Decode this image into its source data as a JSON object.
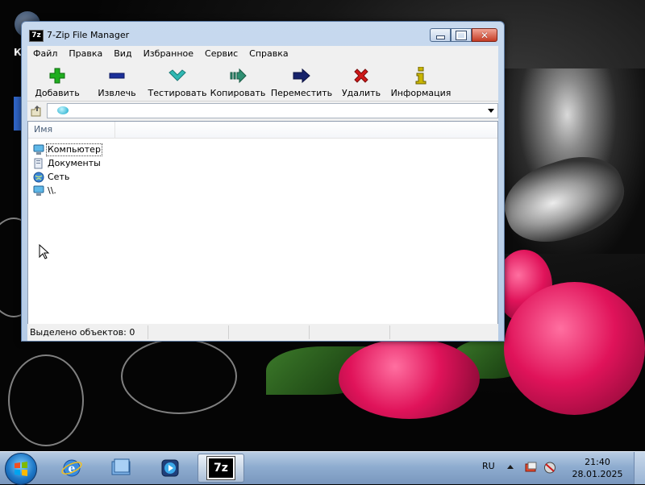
{
  "window": {
    "title": "7-Zip File Manager",
    "app_icon_text": "7z"
  },
  "menu": [
    "Файл",
    "Правка",
    "Вид",
    "Избранное",
    "Сервис",
    "Справка"
  ],
  "toolbar": {
    "add": "Добавить",
    "extract": "Извлечь",
    "test": "Тестировать",
    "copy": "Копировать",
    "move": "Переместить",
    "delete": "Удалить",
    "info": "Информация"
  },
  "address": {
    "value": ""
  },
  "list": {
    "column_name": "Имя",
    "items": [
      {
        "label": "Компьютер",
        "icon": "computer-icon"
      },
      {
        "label": "Документы",
        "icon": "documents-icon"
      },
      {
        "label": "Сеть",
        "icon": "network-icon"
      },
      {
        "label": "\\\\.",
        "icon": "computer-icon"
      }
    ]
  },
  "status": {
    "selected": "Выделено объектов: 0"
  },
  "taskbar": {
    "pinned": [
      "internet-explorer-icon",
      "windows-explorer-icon",
      "media-player-icon",
      "7zip-icon"
    ],
    "active_app_text": "7z",
    "language": "RU",
    "time": "21:40",
    "date": "28.01.2025"
  },
  "colors": {
    "add": "#1fae1f",
    "extract": "#1b2f99",
    "test": "#2fb8b3",
    "copy": "#2f8f72",
    "move": "#17236b",
    "delete": "#d01818",
    "info": "#c9b500"
  }
}
